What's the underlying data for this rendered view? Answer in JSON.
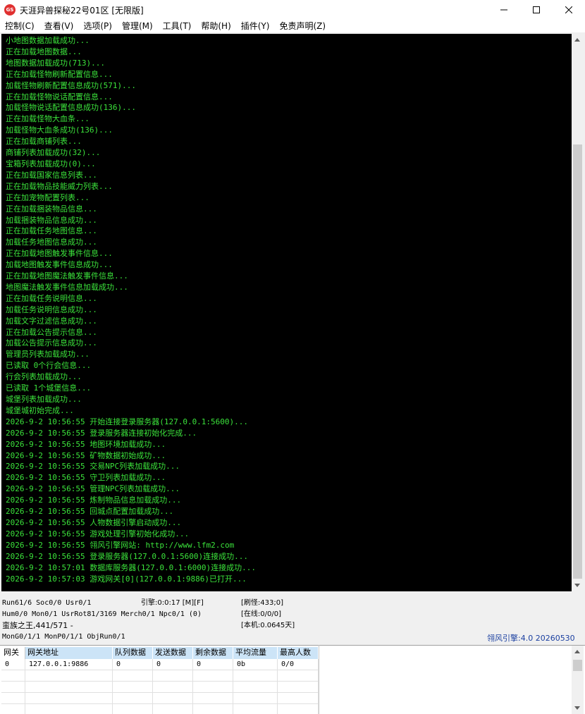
{
  "window": {
    "title": "天涯异兽探秘22号01区 [无限版]",
    "icon_text": "GS",
    "icon_color": "#e03030"
  },
  "menu": [
    {
      "label": "控制(C)"
    },
    {
      "label": "查看(V)"
    },
    {
      "label": "选项(P)"
    },
    {
      "label": "管理(M)"
    },
    {
      "label": "工具(T)"
    },
    {
      "label": "帮助(H)"
    },
    {
      "label": "插件(Y)"
    },
    {
      "label": "免责声明(Z)"
    }
  ],
  "console": {
    "text_color": "#3be33b",
    "background": "#000000",
    "lines": [
      "小地图数据加载成功...",
      "正在加载地图数据...",
      "地图数据加载成功(713)...",
      "正在加载怪物刷新配置信息...",
      "加载怪物刷新配置信息成功(571)...",
      "正在加载怪物说话配置信息...",
      "加载怪物说话配置信息成功(136)...",
      "正在加载怪物大血条...",
      "加载怪物大血条成功(136)...",
      "正在加载商铺列表...",
      "商铺列表加载成功(32)...",
      "宝箱列表加载成功(0)...",
      "正在加载国家信息列表...",
      "正在加载物品技能威力列表...",
      "正在加宠物配置列表...",
      "正在加载捆装物品信息...",
      "加载捆装物品信息成功...",
      "正在加载任务地图信息...",
      "加载任务地图信息成功...",
      "正在加载地图触发事件信息...",
      "加载地图触发事件信息成功...",
      "正在加载地图魔法触发事件信息...",
      "地图魔法触发事件信息加载成功...",
      "正在加载任务说明信息...",
      "加载任务说明信息成功...",
      "加载文字过滤信息成功...",
      "正在加载公告提示信息...",
      "加载公告提示信息成功...",
      "管理员列表加载成功...",
      "已读取 0个行会信息...",
      "行会列表加载成功...",
      "已读取 1个城堡信息...",
      "城堡列表加载成功...",
      "城堡城初始完成...",
      "2026-9-2 10:56:55 开始连接登录服务器(127.0.0.1:5600)...",
      "2026-9-2 10:56:55 登录服务器连接初始化完成...",
      "2026-9-2 10:56:55 地图环境加载成功...",
      "2026-9-2 10:56:55 矿物数据初始成功...",
      "2026-9-2 10:56:55 交易NPC列表加载成功...",
      "2026-9-2 10:56:55 守卫列表加载成功...",
      "2026-9-2 10:56:55 管理NPC列表加载成功...",
      "2026-9-2 10:56:55 炼制物品信息加载成功...",
      "2026-9-2 10:56:55 回城点配置加载成功...",
      "2026-9-2 10:56:55 人物数据引擎启动成功...",
      "2026-9-2 10:56:55 游戏处理引擎初始化成功...",
      "2026-9-2 10:56:55 翎风引擎网站: http://www.lfm2.com",
      "2026-9-2 10:56:55 登录服务器(127.0.0.1:5600)连接成功...",
      "2026-9-2 10:57:01 数据库服务器(127.0.0.1:6000)连接成功...",
      "2026-9-2 10:57:03 游戏网关[0](127.0.0.1:9886)已打开..."
    ]
  },
  "status": {
    "row1_left": "Run61/6 Soc0/0 Usr0/1",
    "row1_mid": "引擎:0:0:17 [M][F]",
    "row1_right": "[刷怪:433;0]",
    "row2_left": "Hum0/0 Mon0/1 UsrRot81/3169 Merch0/1 Npc0/1 (0)",
    "row2_right": "[在线:0/0/0]",
    "row3_left": "蛮族之王,441/571 -",
    "row3_right": "[本机:0.0645天]",
    "row4_left": "MonG0/1/1 MonP0/1/1 ObjRun0/1",
    "engine_label": "翎风引擎:4.0 20260530"
  },
  "gateway": {
    "headers": [
      "网关",
      "网关地址",
      "队列数据",
      "发送数据",
      "剩余数据",
      "平均流量",
      "最高人数"
    ],
    "rows": [
      [
        "0",
        "127.0.0.1:9886",
        "0",
        "0",
        "0",
        "0b",
        "0/0"
      ]
    ]
  }
}
